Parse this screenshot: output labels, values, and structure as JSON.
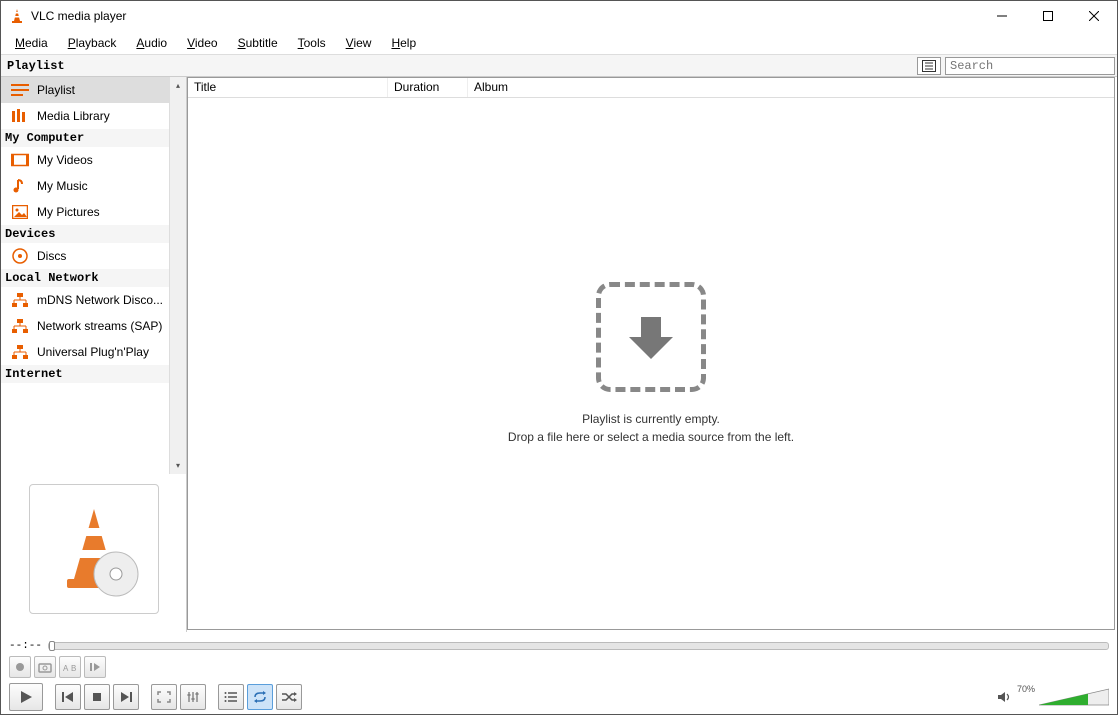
{
  "window": {
    "title": "VLC media player"
  },
  "menus": [
    {
      "label": "Media",
      "u": "M"
    },
    {
      "label": "Playback",
      "u": "P"
    },
    {
      "label": "Audio",
      "u": "A"
    },
    {
      "label": "Video",
      "u": "V"
    },
    {
      "label": "Subtitle",
      "u": "S"
    },
    {
      "label": "Tools",
      "u": "T"
    },
    {
      "label": "View",
      "u": "V"
    },
    {
      "label": "Help",
      "u": "H"
    }
  ],
  "toolbar": {
    "section": "Playlist",
    "search_placeholder": "Search"
  },
  "sidebar": {
    "sections": [
      {
        "header": null,
        "items": [
          {
            "label": "Playlist",
            "icon": "playlist-icon",
            "active": true
          },
          {
            "label": "Media Library",
            "icon": "library-icon"
          }
        ]
      },
      {
        "header": "My Computer",
        "items": [
          {
            "label": "My Videos",
            "icon": "video-icon"
          },
          {
            "label": "My Music",
            "icon": "music-icon"
          },
          {
            "label": "My Pictures",
            "icon": "picture-icon"
          }
        ]
      },
      {
        "header": "Devices",
        "items": [
          {
            "label": "Discs",
            "icon": "disc-icon"
          }
        ]
      },
      {
        "header": "Local Network",
        "items": [
          {
            "label": "mDNS Network Disco...",
            "icon": "network-icon"
          },
          {
            "label": "Network streams (SAP)",
            "icon": "network-icon"
          },
          {
            "label": "Universal Plug'n'Play",
            "icon": "network-icon"
          }
        ]
      },
      {
        "header": "Internet",
        "items": []
      }
    ]
  },
  "list": {
    "columns": {
      "title": "Title",
      "duration": "Duration",
      "album": "Album"
    },
    "empty_line1": "Playlist is currently empty.",
    "empty_line2": "Drop a file here or select a media source from the left."
  },
  "seek": {
    "time": "--:--"
  },
  "volume": {
    "percent_label": "70%",
    "percent": 70
  }
}
